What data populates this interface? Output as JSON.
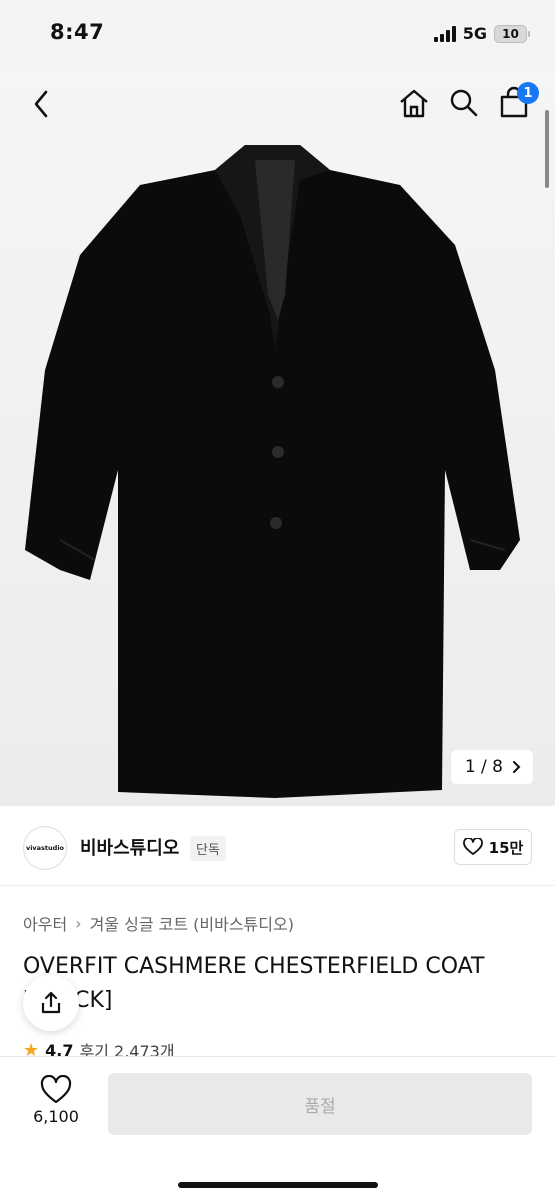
{
  "status": {
    "time": "8:47",
    "network": "5G",
    "battery": "10"
  },
  "nav": {
    "cart_count": "1"
  },
  "gallery": {
    "counter": "1 / 8"
  },
  "brand": {
    "logo_text": "vivastudio",
    "name": "비바스튜디오",
    "tag": "단독",
    "likes": "15만"
  },
  "breadcrumb": {
    "category": "아우터",
    "subcategory": "겨울 싱글 코트 (비바스튜디오)"
  },
  "product": {
    "title": "OVERFIT CASHMERE CHESTERFIELD COAT [BLACK]",
    "rating": "4.7",
    "reviews": "후기 2,473개"
  },
  "bottom": {
    "wish_count": "6,100",
    "buy_label": "품절"
  },
  "colors": {
    "accent": "#1877f2",
    "star": "#f5a623",
    "disabled_bg": "#e9e9e9"
  }
}
